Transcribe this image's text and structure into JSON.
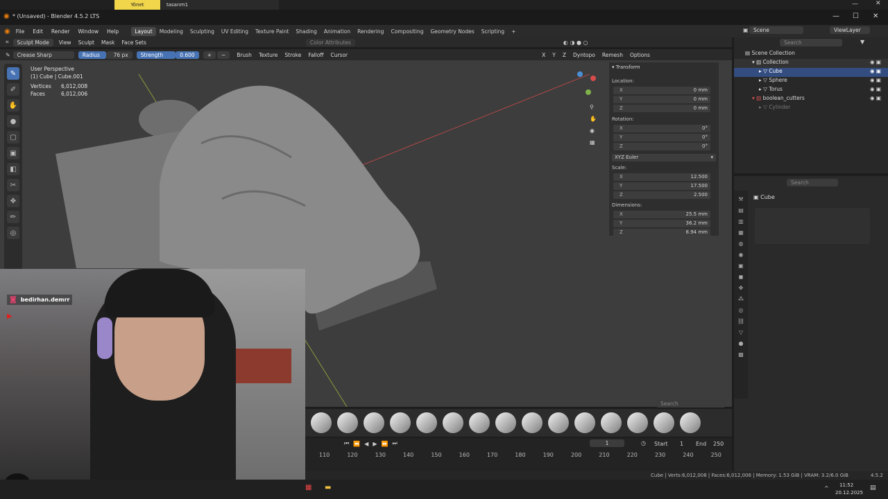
{
  "topstrip": {
    "tab_active": "Yönet",
    "tab_file": "tasarım1"
  },
  "window": {
    "title": "* (Unsaved) - Blender 4.5.2 LTS"
  },
  "menu": [
    "File",
    "Edit",
    "Render",
    "Window",
    "Help"
  ],
  "workspaces": [
    "Layout",
    "Modeling",
    "Sculpting",
    "UV Editing",
    "Texture Paint",
    "Shading",
    "Animation",
    "Rendering",
    "Compositing",
    "Geometry Nodes",
    "Scripting"
  ],
  "workspace_add": "+",
  "scene": {
    "label": "Scene",
    "viewlayer": "ViewLayer"
  },
  "header": {
    "mode": "Sculpt Mode",
    "view": "View",
    "sculpt": "Sculpt",
    "mask": "Mask",
    "face_sets": "Face Sets",
    "color_attributes": "Color Attributes",
    "search_placeholder": "Search"
  },
  "toolsettings": {
    "brush_name": "Crease Sharp",
    "radius_label": "Radius",
    "radius_value": "76 px",
    "strength_label": "Strength",
    "strength_value": "0.600",
    "brush": "Brush",
    "texture": "Texture",
    "stroke": "Stroke",
    "falloff": "Falloff",
    "cursor": "Cursor",
    "axes": [
      "X",
      "Y",
      "Z"
    ],
    "dyntopo": "Dyntopo",
    "remesh": "Remesh",
    "options": "Options"
  },
  "overlay": {
    "perspective": "User Perspective",
    "object": "(1) Cube | Cube.001",
    "vertices_label": "Vertices",
    "vertices_value": "6,012,008",
    "faces_label": "Faces",
    "faces_value": "6,012,006"
  },
  "transform": {
    "title": "Transform",
    "location_label": "Location:",
    "location": [
      {
        "axis": "X",
        "value": "0 mm"
      },
      {
        "axis": "Y",
        "value": "0 mm"
      },
      {
        "axis": "Z",
        "value": "0 mm"
      }
    ],
    "rotation_label": "Rotation:",
    "rotation": [
      {
        "axis": "X",
        "value": "0°"
      },
      {
        "axis": "Y",
        "value": "0°"
      },
      {
        "axis": "Z",
        "value": "0°"
      }
    ],
    "rotation_mode": "XYZ Euler",
    "scale_label": "Scale:",
    "scale": [
      {
        "axis": "X",
        "value": "12.500"
      },
      {
        "axis": "Y",
        "value": "17.500"
      },
      {
        "axis": "Z",
        "value": "2.500"
      }
    ],
    "dimensions_label": "Dimensions:",
    "dimensions": [
      {
        "axis": "X",
        "value": "25.5 mm"
      },
      {
        "axis": "Y",
        "value": "36.2 mm"
      },
      {
        "axis": "Z",
        "value": "8.94 mm"
      }
    ]
  },
  "outliner": {
    "search_placeholder": "Search",
    "scene_collection": "Scene Collection",
    "items": [
      "Collection",
      "Cube",
      "Sphere",
      "Torus",
      "boolean_cutters",
      "Cylinder"
    ]
  },
  "properties": {
    "search_placeholder": "Search",
    "object_name": "Cube"
  },
  "brushbar": {
    "search_placeholder": "Search"
  },
  "timeline": {
    "current_frame": "1",
    "start_label": "Start",
    "start_value": "1",
    "end_label": "End",
    "end_value": "250",
    "ticks": [
      "110",
      "120",
      "130",
      "140",
      "150",
      "160",
      "170",
      "180",
      "190",
      "200",
      "210",
      "220",
      "230",
      "240",
      "250"
    ]
  },
  "statusbar": {
    "text": "Cube | Verts:6,012,008 | Faces:6,012,006 | Memory: 1.53 GiB | VRAM: 3.2/6.0 GiB",
    "version": "4.5.2"
  },
  "webcam": {
    "instagram": "bedirhan.demrr"
  },
  "taskbar": {
    "time": "11:52",
    "date": "20.12.2025"
  },
  "colors": {
    "accent": "#4772b3",
    "viewport_bg": "#3d3d3d",
    "active_tab": "#f1d54a"
  }
}
